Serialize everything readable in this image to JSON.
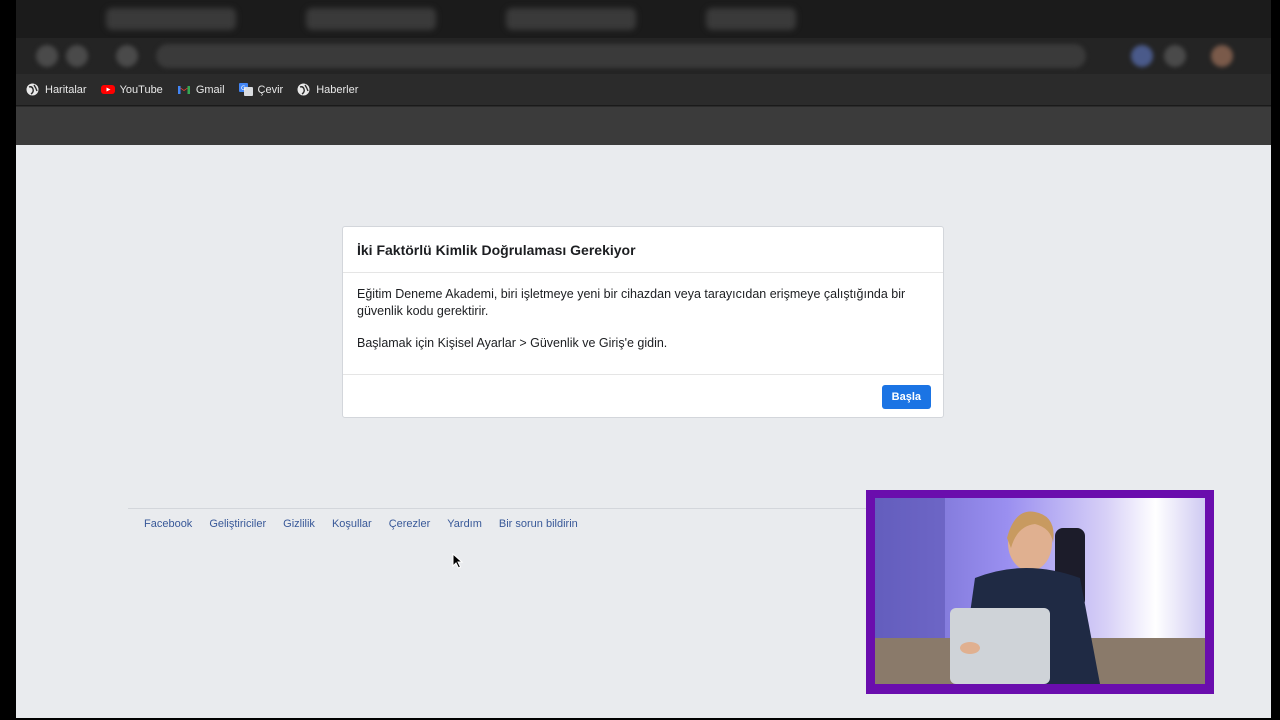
{
  "bookmarks": [
    {
      "label": "Haritalar",
      "icon": "globe-icon"
    },
    {
      "label": "YouTube",
      "icon": "youtube-icon"
    },
    {
      "label": "Gmail",
      "icon": "gmail-icon"
    },
    {
      "label": "Çevir",
      "icon": "translate-icon"
    },
    {
      "label": "Haberler",
      "icon": "globe-icon"
    }
  ],
  "dialog": {
    "title": "İki Faktörlü Kimlik Doğrulaması Gerekiyor",
    "paragraph1": "Eğitim Deneme Akademi, biri işletmeye yeni bir cihazdan veya tarayıcıdan erişmeye çalıştığında bir güvenlik kodu gerektirir.",
    "paragraph2": "Başlamak için Kişisel Ayarlar > Güvenlik ve Giriş'e gidin.",
    "button_label": "Başla"
  },
  "footer_links": [
    "Facebook",
    "Geliştiriciler",
    "Gizlilik",
    "Koşullar",
    "Çerezler",
    "Yardım",
    "Bir sorun bildirin"
  ],
  "colors": {
    "primary_button": "#1b74e4",
    "link": "#385898",
    "page_background": "#e9ebee",
    "webcam_frame": "#6a0dad"
  }
}
